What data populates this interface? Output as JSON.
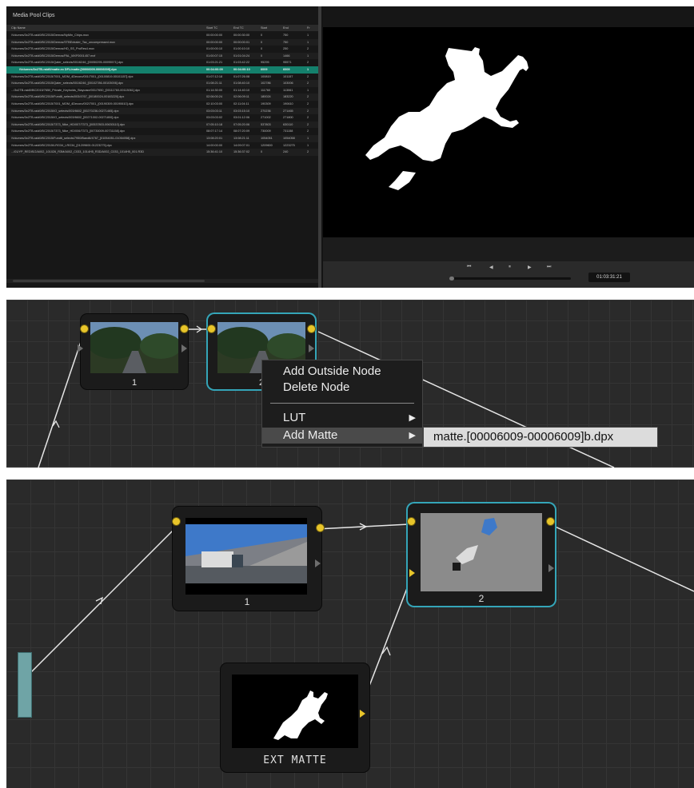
{
  "media_pool": {
    "title": "Media Pool Clips",
    "columns": [
      "Clip Name",
      "Start TC",
      "End TC",
      "Start",
      "End",
      "Fr"
    ],
    "rows": [
      [
        "/Volumes/3x2TB-raid0/BC2015/Demos/NyMin_Chips.mov",
        "00:00:00:00",
        "00:00:30:00",
        "0",
        "750",
        "1"
      ],
      [
        "/Volumes/3x2TB-raid0/BC2015/Demos/STBExtraler_Tac_uncompressed.mov",
        "00:00:00:00",
        "00:00:00:01",
        "0",
        "750",
        "1"
      ],
      [
        "/Volumes/3x2TB-raid0/BC2015/Demos/HD_SS_ProRes4.mov",
        "01:00:00:10",
        "01:00:10:10",
        "0",
        "250",
        "2"
      ],
      [
        "/Volumes/3x2TB-raid0/BC2015/Demos/PAL_MXF0001457.mxf",
        "01:00:07:15",
        "01:01:04:24",
        "0",
        "1466",
        "1"
      ],
      [
        "/Volumes/3x2TB-raid0/BC2015/Qater_selects/001/6246_[00050295-00095571].dpx",
        "01:03:21:21",
        "01:03:42:22",
        "95295",
        "95571",
        "2"
      ],
      [
        "/Volumes/3x2TB-raid0/matte.ex DFL/matte.[00006009-00006009].dpx",
        "00:04:00:09",
        "00:04:00:10",
        "6009",
        "6009",
        "1"
      ],
      [
        "/Volumes/3x2TB-raid0/BC2015/7001_MOM_4Decoro/001/7001_[00100819-00101157].dpx",
        "01:07:12:18",
        "01:07:26:08",
        "100819",
        "101157",
        "2"
      ],
      [
        "/Volumes/3x2TB-raid0/BC2015/Qater_selects/001/6246_[00102786-00103006].dpx",
        "01:08:21:11",
        "01:08:40:10",
        "102786",
        "103006",
        "2"
      ],
      [
        ".../3x2TB-raid0/BC2015/7650_Private_Keyholds_Staycase/001/7650_[00111760-00113061].dpx",
        "01:14:30:00",
        "01:14:40:10",
        "111760",
        "113061",
        "1"
      ],
      [
        "/Volumes/3x2TB-raid0/BC2015/Fund6_selects/003/4767_[00180024-00183220].dpx",
        "02:06:00:24",
        "02:06:09:11",
        "180024",
        "183220",
        "2"
      ],
      [
        "/Volumes/3x2TB-raid0/BC2015/7001_MOM_4Decoro/002/7001_[00190309-00190610].dpx",
        "02:10:03:00",
        "02:11:04:11",
        "190309",
        "190610",
        "2"
      ],
      [
        "/Volumes/3x2TB-raid0/BC2015/IO_selects/003/6602_[00270236-00271465].dpx",
        "03:03:03:11",
        "03:03:15:10",
        "270236",
        "271465",
        "2"
      ],
      [
        "/Volumes/3x2TB-raid0/BC2015/IO_selects/003/6602_[00271002-00271800].dpx",
        "03:03:03:02",
        "03:01:12:06",
        "271002",
        "271800",
        "2"
      ],
      [
        "/Volumes/3x2TB-raid0/BC2015/7373_Nike_HD/007/7373_[00537803-00630110].dpx",
        "07:05:10:18",
        "07:05:20:06",
        "537803",
        "630110",
        "2"
      ],
      [
        "/Volumes/3x2TB-raid0/BC2015/7373_Nike_HD/006/7373_[00730009-00731158].dpx",
        "08:07:17:14",
        "08:07:20:09",
        "730009",
        "731158",
        "2"
      ],
      [
        "/Volumes/3x2TB-raid0/BC2015/Fund6_selects/7950/Band6/4767_[01054051-01054058].dpx",
        "13:08:20:01",
        "13:08:21:11",
        "1054051",
        "1054058",
        "1"
      ],
      [
        "/Volumes/3x2TB-raid0/BC2015/LRG34_LRG34_[01209600-01223275].dpx",
        "14:00:00:00",
        "14:09:07:01",
        "1209600",
        "1223275",
        "1"
      ],
      [
        ".../01/YP_REDIS/2/A002_101026_R3M/A002_C033_1014H5_R3D/A002_C033_1014H5_001.R3D",
        "15:36:41:10",
        "15:36:37:02",
        "0",
        "240",
        "2"
      ]
    ]
  },
  "viewer": {
    "transport": [
      "⏮",
      "◀",
      "⏸",
      "▶",
      "⏭"
    ],
    "timecode": "01:03:31:21"
  },
  "node_graph_menu": {
    "node1_label": "1",
    "node2_label": "2",
    "menu_items": [
      "Add Outside Node",
      "Delete Node",
      "LUT",
      "Add Matte"
    ],
    "submenu_item": "matte.[00006009-00006009]b.dpx"
  },
  "node_graph_result": {
    "node1_label": "1",
    "node2_label": "2",
    "matte_label": "EXT MATTE"
  },
  "colors": {
    "selection_row": "#14806c",
    "node_selected_outline": "#34a5b8",
    "connector": "#e8c52a"
  },
  "icons": [
    "horse-silhouette-matte",
    "road-truck-thumbnail",
    "tree-road-thumbnail"
  ]
}
